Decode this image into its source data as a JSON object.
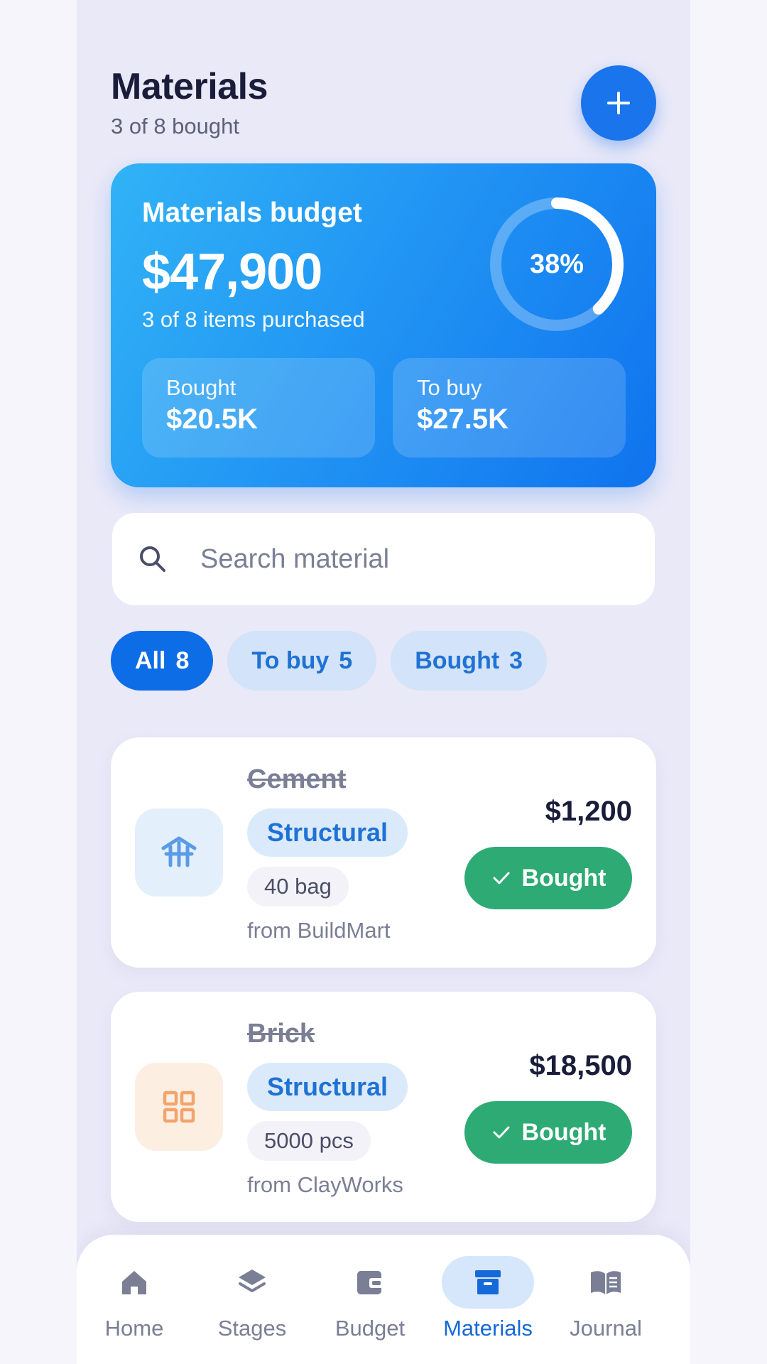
{
  "header": {
    "title": "Materials",
    "subtitle": "3 of 8 bought"
  },
  "budget": {
    "label": "Materials budget",
    "total": "$47,900",
    "subtitle": "3 of 8 items purchased",
    "percent_text": "38%",
    "percent": 38,
    "bought_label": "Bought",
    "bought_value": "$20.5K",
    "to_buy_label": "To buy",
    "to_buy_value": "$27.5K"
  },
  "search": {
    "placeholder": "Search material"
  },
  "filters": [
    {
      "label": "All",
      "count": "8",
      "active": true
    },
    {
      "label": "To buy",
      "count": "5",
      "active": false
    },
    {
      "label": "Bought",
      "count": "3",
      "active": false
    }
  ],
  "materials": [
    {
      "name": "Cement",
      "category": "Structural",
      "quantity": "40 bag",
      "supplier": "from BuildMart",
      "price": "$1,200",
      "status": "Bought",
      "icon": "building-frame-icon",
      "icon_color": "#5b9be6",
      "icon_bg": "#e4effc"
    },
    {
      "name": "Brick",
      "category": "Structural",
      "quantity": "5000 pcs",
      "supplier": "from ClayWorks",
      "price": "$18,500",
      "status": "Bought",
      "icon": "grid-icon",
      "icon_color": "#f2a46c",
      "icon_bg": "#fdeee2"
    }
  ],
  "nav": [
    {
      "label": "Home",
      "icon": "home-icon",
      "active": false
    },
    {
      "label": "Stages",
      "icon": "layers-icon",
      "active": false
    },
    {
      "label": "Budget",
      "icon": "wallet-icon",
      "active": false
    },
    {
      "label": "Materials",
      "icon": "box-icon",
      "active": true
    },
    {
      "label": "Journal",
      "icon": "book-icon",
      "active": false
    }
  ],
  "colors": {
    "accent": "#1a74ec",
    "success": "#2eaa74",
    "background": "#e9e9f8"
  }
}
